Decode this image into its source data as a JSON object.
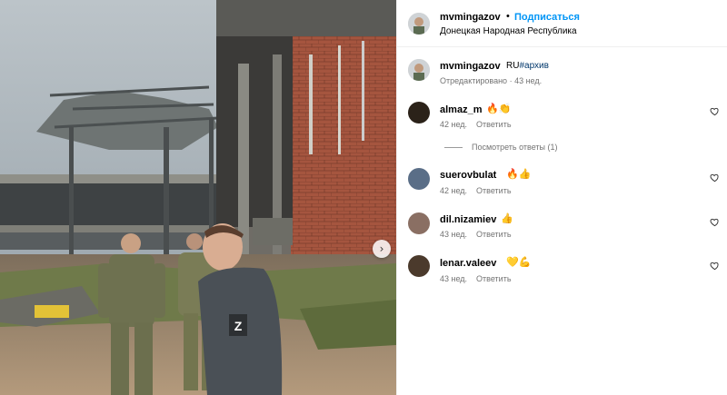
{
  "post": {
    "username": "mvmingazov",
    "dot": "•",
    "follow_label": "Подписаться",
    "location": "Донецкая Народная Республика"
  },
  "caption": {
    "username": "mvmingazov",
    "lang": "RU",
    "tag": "#архив",
    "edited": "Отредактировано",
    "time": "43 нед."
  },
  "comments": [
    {
      "username": "almaz_m",
      "emoji": "🔥👏",
      "time": "42 нед.",
      "reply": "Ответить",
      "avatar_color": "#2b2219"
    },
    {
      "username": "suerovbulat",
      "emoji": "🔥👍",
      "time": "42 нед.",
      "reply": "Ответить",
      "avatar_color": "#5a6e87"
    },
    {
      "username": "dil.nizamiev",
      "emoji": "👍",
      "time": "43 нед.",
      "reply": "Ответить",
      "avatar_color": "#8a6f63"
    },
    {
      "username": "lenar.valeev",
      "emoji": "💛💪",
      "time": "43 нед.",
      "reply": "Ответить",
      "avatar_color": "#4b3a2c"
    }
  ],
  "view_replies": "Посмотреть ответы (1)",
  "colors": {
    "accent": "#0095f6",
    "meta": "#737373"
  },
  "icons": {
    "next": "chevron-right-icon",
    "like": "heart-outline-icon"
  }
}
